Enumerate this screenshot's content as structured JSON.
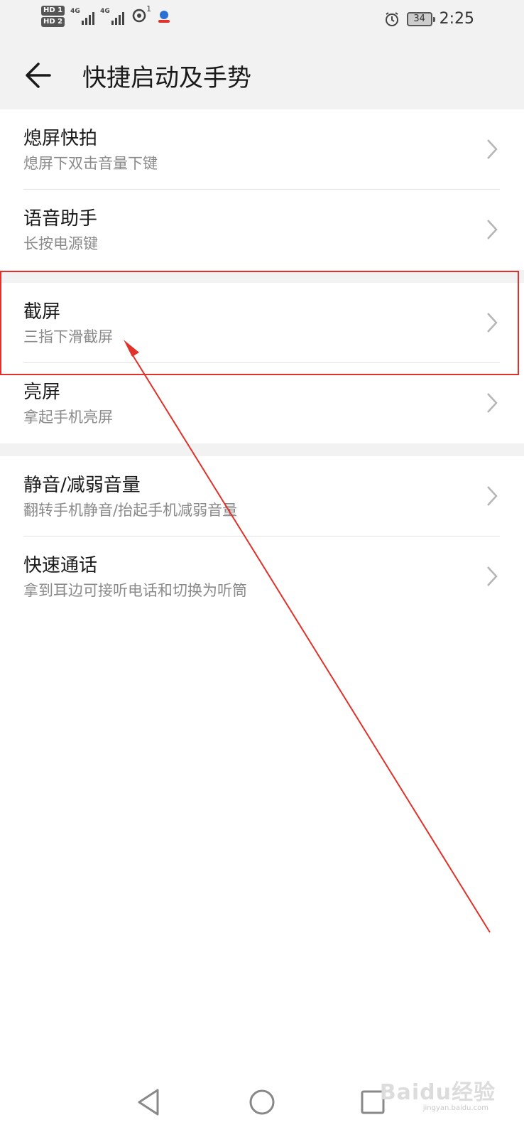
{
  "status_bar": {
    "hd1": "HD 1",
    "hd2": "HD 2",
    "net1": "4G",
    "net2": "4G",
    "hotspot_count": "1",
    "battery": "34",
    "time": "2:25"
  },
  "header": {
    "title": "快捷启动及手势"
  },
  "items": [
    {
      "title": "熄屏快拍",
      "subtitle": "熄屏下双击音量下键"
    },
    {
      "title": "语音助手",
      "subtitle": "长按电源键"
    },
    {
      "title": "截屏",
      "subtitle": "三指下滑截屏"
    },
    {
      "title": "亮屏",
      "subtitle": "拿起手机亮屏"
    },
    {
      "title": "静音/减弱音量",
      "subtitle": "翻转手机静音/抬起手机减弱音量"
    },
    {
      "title": "快速通话",
      "subtitle": "拿到耳边可接听电话和切换为听筒"
    }
  ],
  "watermark": {
    "text": "Baidu经验",
    "url": "jingyan.baidu.com"
  },
  "colors": {
    "annotation": "#e0322a",
    "group_bg": "#f2f2f2",
    "subtitle": "#8a8a8a"
  }
}
